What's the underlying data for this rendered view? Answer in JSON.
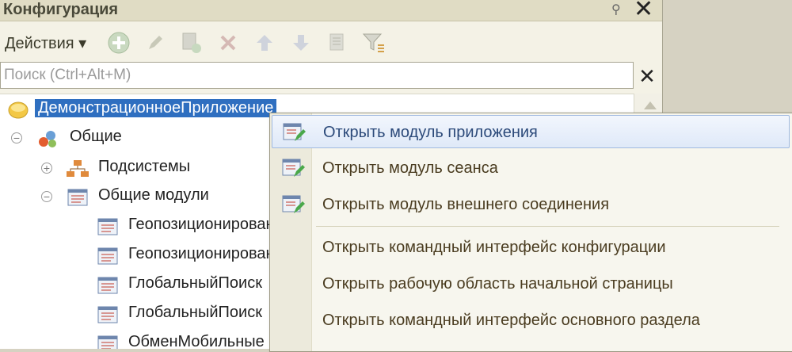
{
  "window": {
    "title": "Конфигурация"
  },
  "toolbar": {
    "actions_label": "Действия ▾"
  },
  "search": {
    "placeholder": "Поиск (Ctrl+Alt+M)"
  },
  "tree": {
    "root": "ДемонстрационноеПриложение",
    "general": "Общие",
    "subsystems": "Подсистемы",
    "common_modules": "Общие модули",
    "modules": [
      "Геопозиционировани",
      "Геопозиционировани",
      "ГлобальныйПоиск",
      "ГлобальныйПоиск",
      "ОбменМобильные"
    ]
  },
  "context_menu": {
    "items": [
      "Открыть модуль приложения",
      "Открыть модуль сеанса",
      "Открыть модуль внешнего соединения",
      "Открыть командный интерфейс конфигурации",
      "Открыть рабочую область начальной страницы",
      "Открыть командный интерфейс основного раздела"
    ]
  }
}
